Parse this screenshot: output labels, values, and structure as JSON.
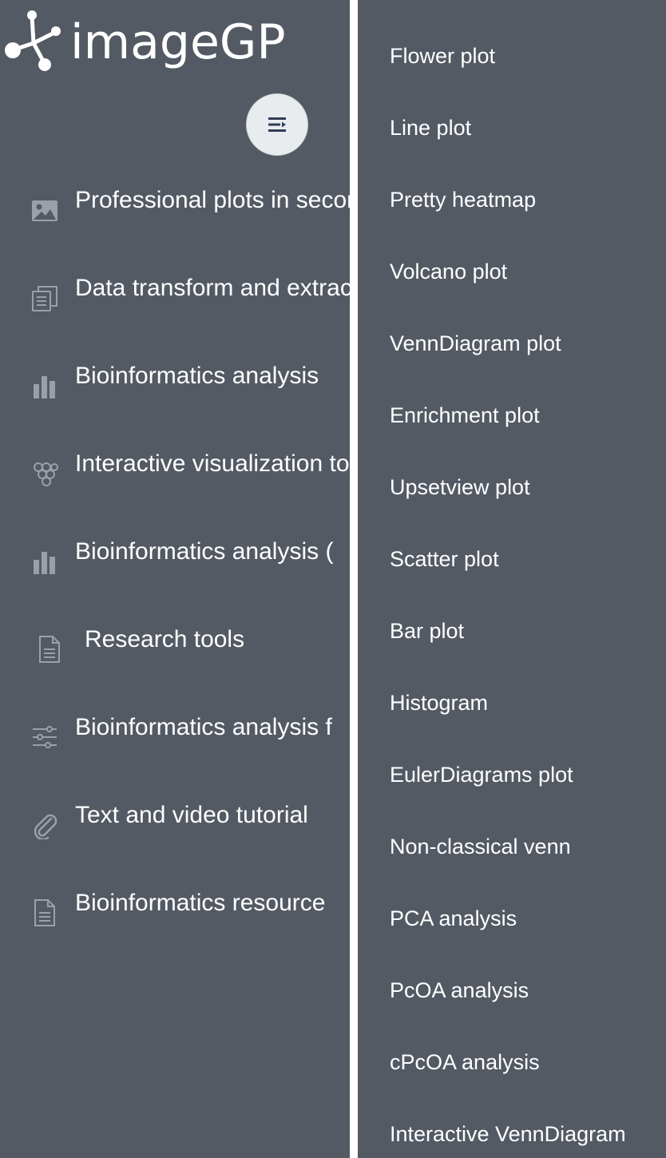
{
  "app": {
    "logo_text": "imageGP",
    "toggle_icon": "menu-fold-icon"
  },
  "sidebar": {
    "items": [
      {
        "label": "Professional plots in seconds",
        "icon": "image-icon"
      },
      {
        "label": "Data transform and extraction",
        "icon": "copy-icon"
      },
      {
        "label": "Bioinformatics analysis",
        "icon": "bar-chart-icon"
      },
      {
        "label": "Interactive visualization tools",
        "icon": "grapes-icon"
      },
      {
        "label": "Bioinformatics analysis (",
        "icon": "bar-chart-icon"
      },
      {
        "label": "Research tools",
        "icon": "file-text-icon"
      },
      {
        "label": "Bioinformatics analysis f",
        "icon": "sliders-icon"
      },
      {
        "label": "Text and video tutorial",
        "icon": "paperclip-icon"
      },
      {
        "label": "Bioinformatics resource",
        "icon": "file-text-icon"
      }
    ]
  },
  "submenu": {
    "items": [
      "Flower plot",
      "Line plot",
      "Pretty heatmap",
      "Volcano plot",
      "VennDiagram plot",
      "Enrichment plot",
      "Upsetview plot",
      "Scatter plot",
      "Bar plot",
      "Histogram",
      "EulerDiagrams plot",
      "Non-classical venn",
      "PCA analysis",
      "PcOA analysis",
      "cPcOA analysis",
      "Interactive VennDiagram"
    ]
  },
  "colors": {
    "background": "#545a64",
    "text": "#ffffff",
    "icon": "#9aa0a8",
    "toggle_bg": "#e9ecee",
    "toggle_icon": "#2f3d55",
    "divider": "#ffffff"
  }
}
